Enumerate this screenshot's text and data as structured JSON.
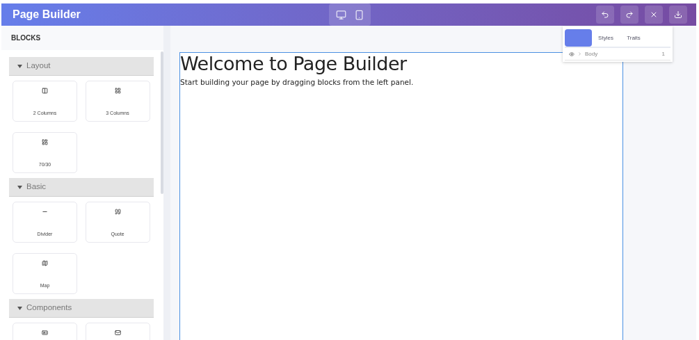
{
  "header": {
    "title": "Page Builder",
    "devices": [
      {
        "kind": "desktop"
      },
      {
        "kind": "mobile"
      }
    ],
    "actions": [
      {
        "kind": "undo"
      },
      {
        "kind": "redo"
      },
      {
        "kind": "close"
      },
      {
        "kind": "download"
      }
    ]
  },
  "sidebar": {
    "heading": "BLOCKS",
    "categories": [
      {
        "label": "Layout",
        "expanded": true,
        "blocks": [
          {
            "kind": "columns-2",
            "label": "2 Columns"
          },
          {
            "kind": "grid",
            "label": "3 Columns"
          },
          {
            "kind": "layout",
            "label": "70/30"
          }
        ]
      },
      {
        "label": "Basic",
        "expanded": true,
        "blocks": [
          {
            "kind": "divider",
            "label": "Divider"
          },
          {
            "kind": "quote",
            "label": "Quote"
          },
          {
            "kind": "map",
            "label": "Map"
          }
        ]
      },
      {
        "label": "Components",
        "expanded": true,
        "blocks": [
          {
            "kind": "card"
          },
          {
            "kind": "mail"
          }
        ]
      }
    ]
  },
  "panel": {
    "tabs": [
      {
        "selected": true
      },
      {
        "label": "Styles",
        "selected": false
      },
      {
        "label": "Traits",
        "selected": false
      }
    ],
    "layers": [
      {
        "name": "Body",
        "count": "1",
        "visible": true
      }
    ]
  },
  "canvas": {
    "heading": "Welcome to Page Builder",
    "text": "Start building your page by dragging blocks from the left panel."
  }
}
